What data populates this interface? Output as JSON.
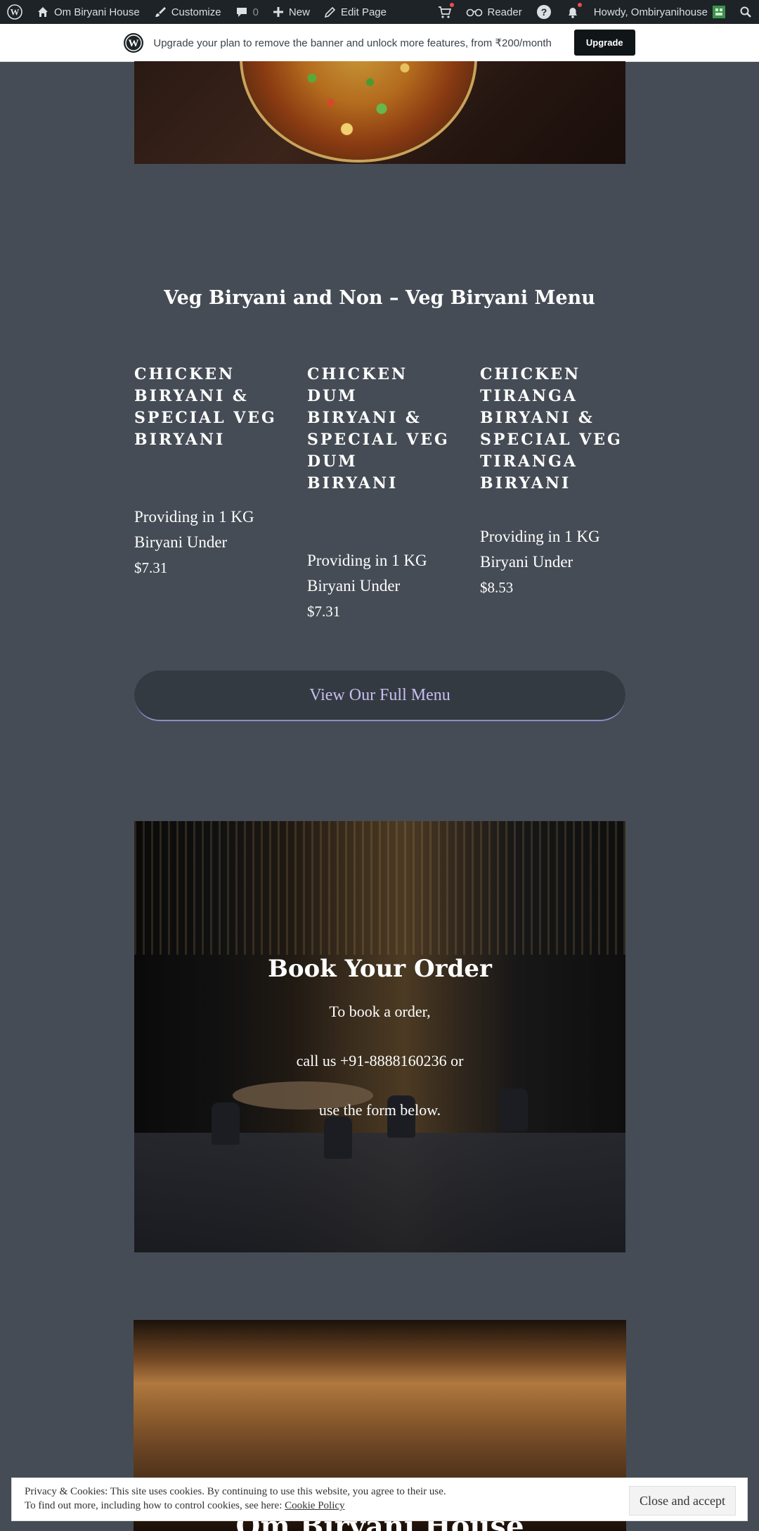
{
  "adminbar": {
    "site_name": "Om Biryani House",
    "customize": "Customize",
    "comments_count": "0",
    "new": "New",
    "edit_page": "Edit Page",
    "reader": "Reader",
    "howdy": "Howdy, Ombiryanihouse"
  },
  "banner": {
    "text": "Upgrade your plan to remove the banner and unlock more features, from ₹200/month",
    "button": "Upgrade"
  },
  "menu": {
    "title": "Veg Biryani and Non – Veg Biryani Menu",
    "items": [
      {
        "name": "Chicken Biryani & Special Veg Biryani",
        "desc": "Providing in 1 KG Biryani Under",
        "price": "$7.31"
      },
      {
        "name": "Chicken Dum Biryani & Special Veg Dum Biryani",
        "desc": "Providing in 1 KG Biryani Under",
        "price": "$7.31"
      },
      {
        "name": "Chicken Tiranga Biryani & Special Veg Tiranga Biryani",
        "desc": "Providing in 1 KG Biryani Under",
        "price": "$8.53"
      }
    ],
    "full_menu_button": "View Our Full Menu"
  },
  "book": {
    "title": "Book Your Order",
    "line1": "To book a order,",
    "line2": "call us +91-8888160236 or",
    "line3": "use the form below."
  },
  "biryani_section": {
    "title": "Om Biryani House"
  },
  "cookie": {
    "line1": "Privacy & Cookies: This site uses cookies. By continuing to use this website, you agree to their use.",
    "line2": "To find out more, including how to control cookies, see here:",
    "link": "Cookie Policy",
    "button": "Close and accept"
  }
}
